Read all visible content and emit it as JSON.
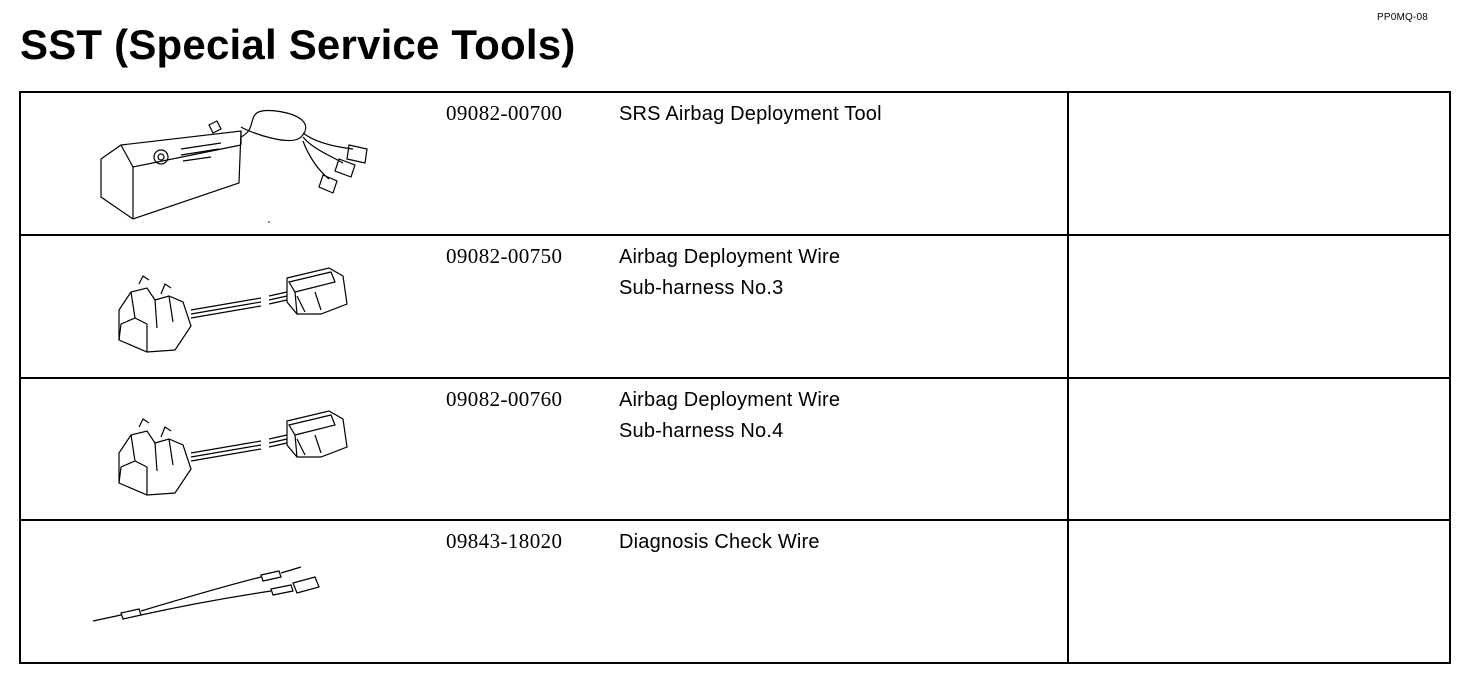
{
  "doc_code": "PP0MQ-08",
  "title": "SST (Special Service Tools)",
  "tools": [
    {
      "part_number": "09082-00700",
      "name_lines": [
        "SRS Airbag Deployment Tool"
      ],
      "icon": "airbag-deployment-tool-icon"
    },
    {
      "part_number": "09082-00750",
      "name_lines": [
        "Airbag Deployment Wire",
        "Sub-harness No.3"
      ],
      "icon": "sub-harness-connector-icon"
    },
    {
      "part_number": "09082-00760",
      "name_lines": [
        "Airbag Deployment Wire",
        "Sub-harness No.4"
      ],
      "icon": "sub-harness-connector-icon"
    },
    {
      "part_number": "09843-18020",
      "name_lines": [
        "Diagnosis Check Wire"
      ],
      "icon": "check-wire-icon"
    }
  ]
}
